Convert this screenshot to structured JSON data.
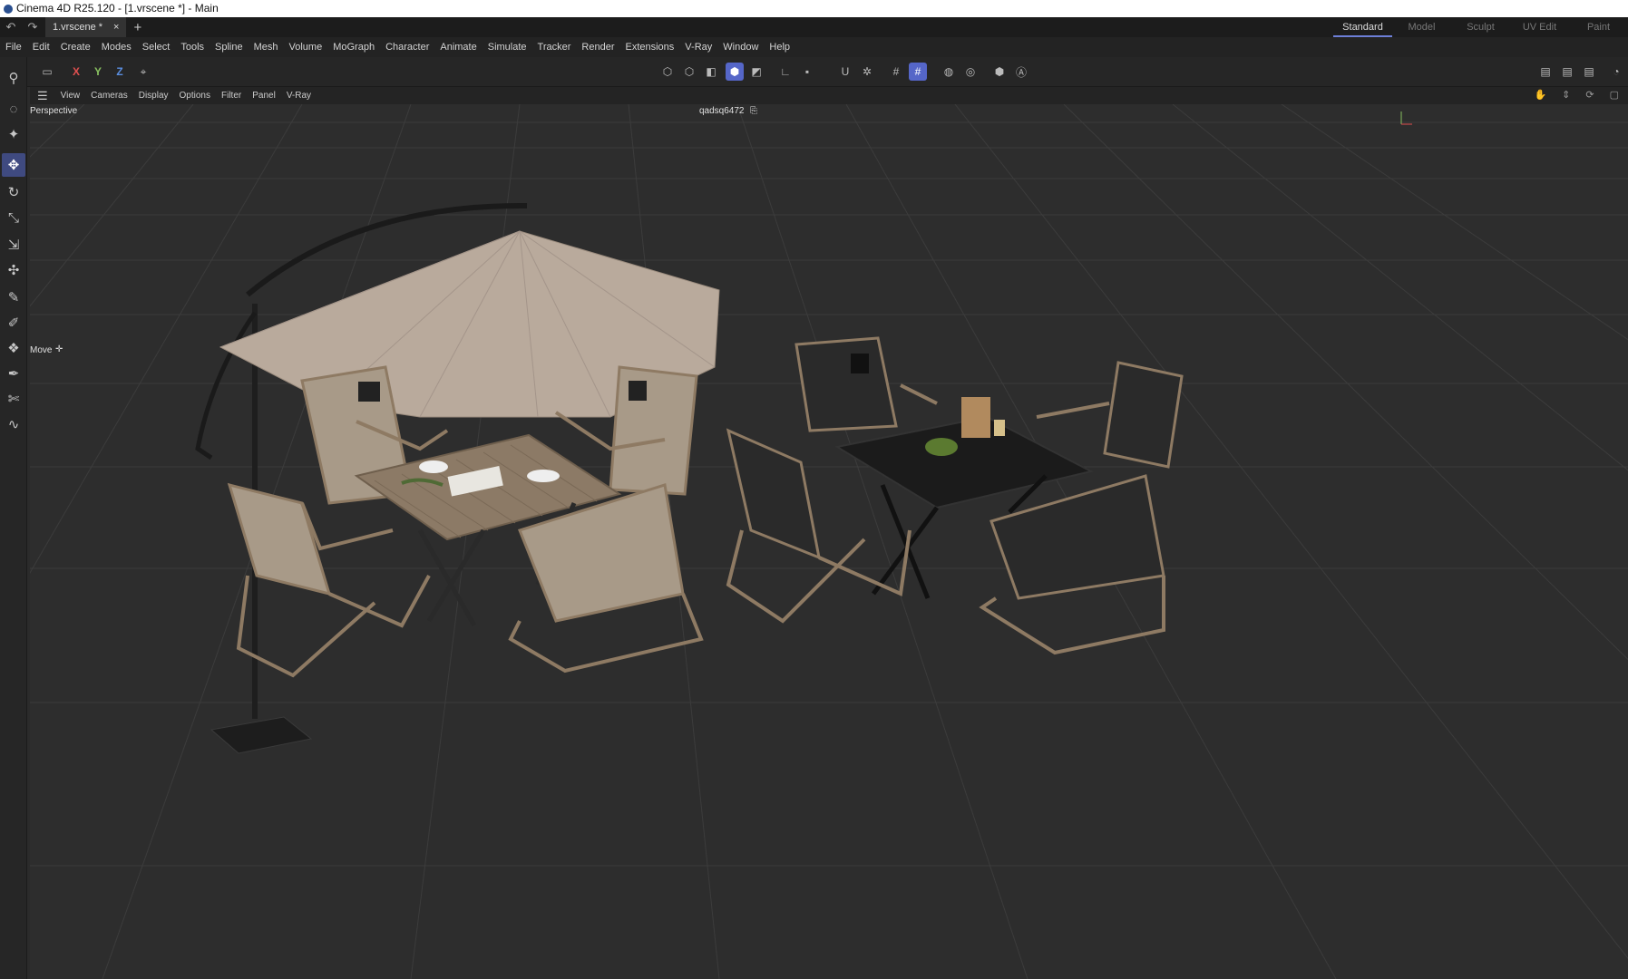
{
  "window": {
    "title": "Cinema 4D R25.120 - [1.vrscene *] - Main"
  },
  "tabs": {
    "doc_tab": "1.vrscene *",
    "close": "×",
    "add": "+"
  },
  "layouts": [
    "Standard",
    "Model",
    "Sculpt",
    "UV Edit",
    "Paint"
  ],
  "menu": [
    "File",
    "Edit",
    "Create",
    "Modes",
    "Select",
    "Tools",
    "Spline",
    "Mesh",
    "Volume",
    "MoGraph",
    "Character",
    "Animate",
    "Simulate",
    "Tracker",
    "Render",
    "Extensions",
    "V-Ray",
    "Window",
    "Help"
  ],
  "toolbar": {
    "axis_x": "X",
    "axis_y": "Y",
    "axis_z": "Z"
  },
  "viewport_menu": [
    "View",
    "Cameras",
    "Display",
    "Options",
    "Filter",
    "Panel",
    "V-Ray"
  ],
  "viewport": {
    "camera_label": "Perspective",
    "object_label": "qadsq6472",
    "tool_label": "Move",
    "axis_y": "Y"
  },
  "colors": {
    "accent": "#5566c8",
    "background": "#2d2d2d",
    "grid": "#3e3e3e",
    "umbrella": "#b9aa9c",
    "beige_fabric": "#a89a88",
    "dark_fabric": "#2a2a2a",
    "frame": "#8e7a63"
  }
}
